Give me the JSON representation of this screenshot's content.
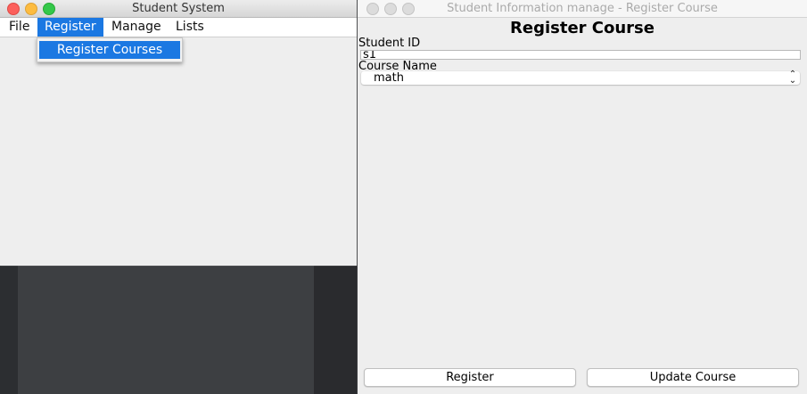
{
  "student_system": {
    "title": "Student System",
    "menu": [
      "File",
      "Register",
      "Manage",
      "Lists"
    ],
    "active_menu": "Register",
    "dropdown": {
      "items": [
        "Register Courses"
      ]
    }
  },
  "register_window": {
    "title": "Student Information manage - Register Course",
    "heading": "Register Course",
    "student_id_label": "Student ID",
    "student_id_value": "s1",
    "course_name_label": "Course Name",
    "course_name_value": "math",
    "buttons": {
      "register": "Register",
      "update": "Update Course"
    }
  },
  "colors": {
    "accent": "#1b78e2",
    "close": "#fc605c",
    "minimize": "#fdbc40",
    "maximize": "#34c84a"
  },
  "icons": {
    "select_arrow": "up-down-chevron-icon"
  }
}
